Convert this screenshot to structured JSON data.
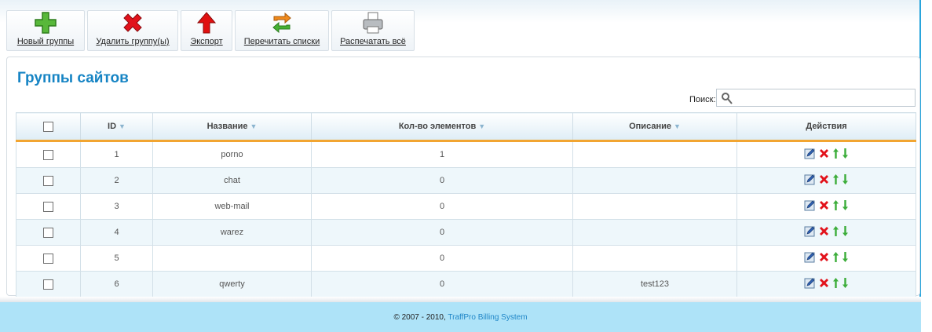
{
  "toolbar": {
    "buttons": [
      {
        "label": "Новый группы",
        "icon": "add-icon"
      },
      {
        "label": "Удалить группу(ы)",
        "icon": "delete-icon"
      },
      {
        "label": "Экспорт",
        "icon": "export-icon"
      },
      {
        "label": "Перечитать списки",
        "icon": "refresh-icon"
      },
      {
        "label": "Распечатать всё",
        "icon": "print-icon"
      }
    ]
  },
  "page": {
    "title": "Группы сайтов"
  },
  "search": {
    "label": "Поиск:",
    "value": ""
  },
  "table": {
    "headers": {
      "id": "ID",
      "name": "Название",
      "count": "Кол-во элементов",
      "description": "Описание",
      "actions": "Действия"
    },
    "rows": [
      {
        "id": "1",
        "name": "porno",
        "count": "1",
        "description": ""
      },
      {
        "id": "2",
        "name": "chat",
        "count": "0",
        "description": ""
      },
      {
        "id": "3",
        "name": "web-mail",
        "count": "0",
        "description": ""
      },
      {
        "id": "4",
        "name": "warez",
        "count": "0",
        "description": ""
      },
      {
        "id": "5",
        "name": "",
        "count": "0",
        "description": ""
      },
      {
        "id": "6",
        "name": "qwerty",
        "count": "0",
        "description": "test123"
      }
    ]
  },
  "footer": {
    "copyright": "© 2007 - 2010, ",
    "link": "TraffPro Billing System"
  },
  "colors": {
    "accent": "#1684c4",
    "header_underline": "#f2a531",
    "footer_bg": "#aee3f8"
  }
}
